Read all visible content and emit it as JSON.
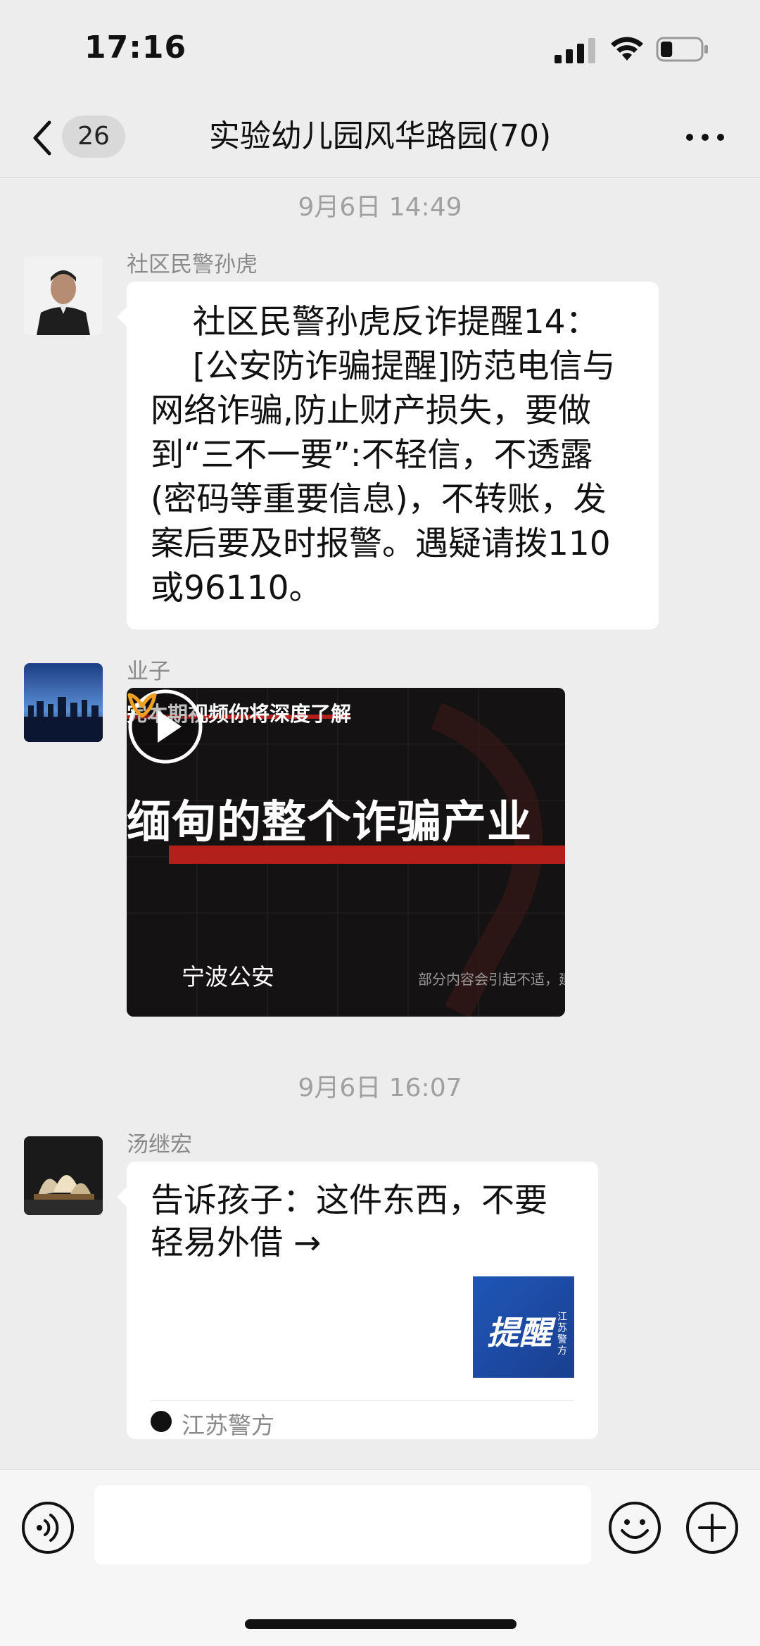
{
  "status_bar": {
    "time": "17:16",
    "battery_level": 0.3
  },
  "nav": {
    "unread_count": "26",
    "title": "实验幼儿园风华路园(70)"
  },
  "messages": [
    {
      "timestamp": "9月6日 14:49"
    },
    {
      "sender": "社区民警孙虎",
      "text": "    社区民警孙虎反诈提醒14：\n    [公安防诈骗提醒]防范电信与网络诈骗,防止财产损失，要做到“三不一要”:不轻信，不透露(密码等重要信息)，不转账，发案后要及时报警。遇疑请拨110或96110。"
    },
    {
      "sender": "业子",
      "video": {
        "top_caption": "完本期视频你将深度了解",
        "main_caption": "缅甸的整个诈骗产业",
        "source": "宁波公安",
        "disclaimer": "部分内容会引起不适，建"
      }
    },
    {
      "timestamp": "9月6日 16:07"
    },
    {
      "sender": "汤继宏",
      "article": {
        "title": "告诉孩子：这件东西，不要轻易外借 →",
        "thumb_text": "提醒",
        "thumb_sub": "江苏警方",
        "source": "江苏警方"
      }
    }
  ],
  "colors": {
    "background": "#ededed",
    "bubble": "#ffffff",
    "thumb_blue": "#1f56b8",
    "video_red": "#b3201c",
    "accent_orange": "#f0a020"
  },
  "icons": [
    "back-icon",
    "more-icon",
    "play-icon",
    "voice-icon",
    "emoji-icon",
    "plus-icon"
  ]
}
